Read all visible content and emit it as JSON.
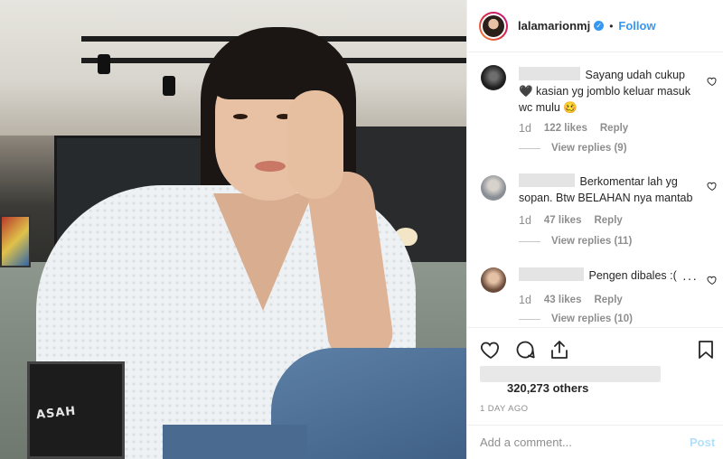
{
  "header": {
    "username": "lalamarionmj",
    "dot": "•",
    "follow_label": "Follow"
  },
  "comments": [
    {
      "text": "Sayang udah cukup 🖤 kasian yg jomblo keluar masuk wc mulu 🥴",
      "time": "1d",
      "likes": "122 likes",
      "reply_label": "Reply",
      "view_replies": "View replies (9)"
    },
    {
      "text": "Berkomentar lah yg sopan. Btw BELAHAN nya mantab",
      "time": "1d",
      "likes": "47 likes",
      "reply_label": "Reply",
      "view_replies": "View replies (11)"
    },
    {
      "text": "Pengen dibales :(",
      "time": "1d",
      "likes": "43 likes",
      "reply_label": "Reply",
      "view_replies": "View replies (10)"
    }
  ],
  "photo": {
    "bag_text": "ASAH"
  },
  "likes_others": "320,273 others",
  "time_ago": "1 DAY AGO",
  "add_comment": {
    "placeholder": "Add a comment...",
    "post_label": "Post"
  },
  "icons": [
    "heart-icon",
    "comment-icon",
    "share-icon",
    "bookmark-icon",
    "verified-icon",
    "more-icon"
  ],
  "colors": {
    "accent": "#3897f0",
    "post_disabled": "#b2dffc",
    "muted": "#8e8e8e"
  }
}
